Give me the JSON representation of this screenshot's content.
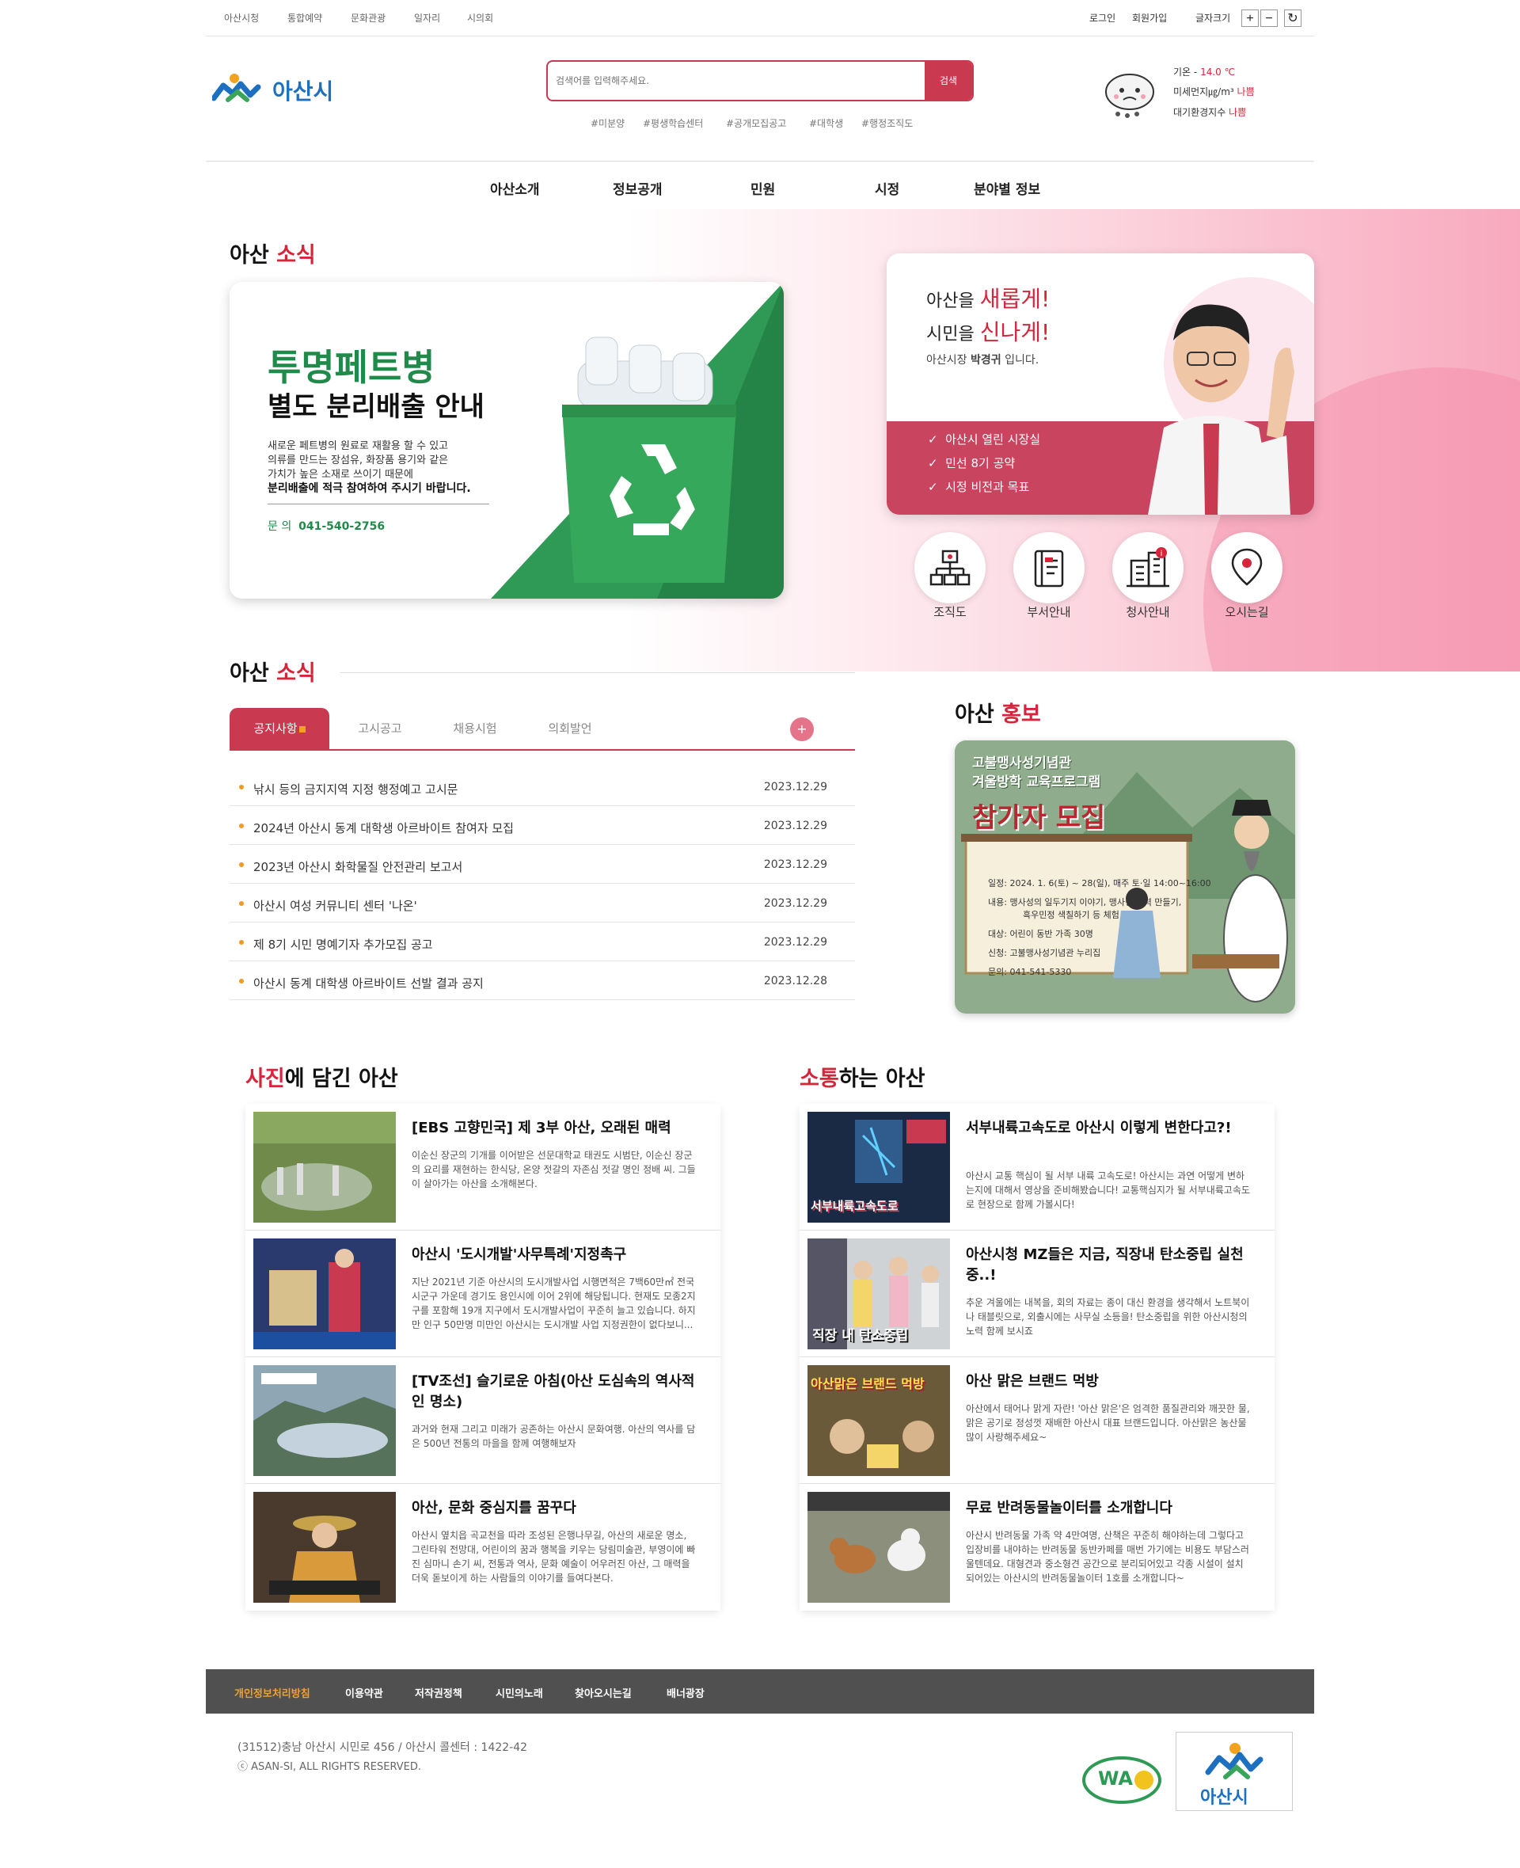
{
  "topbar": {
    "links": [
      "아산시청",
      "통합예약",
      "문화관광",
      "일자리",
      "시의회"
    ],
    "login": "로그인",
    "signup": "회원가입",
    "font_size_label": "글자크기",
    "zoom_in": "+",
    "zoom_out": "−",
    "reset": "↻"
  },
  "header": {
    "logo_text": "아산시",
    "search_placeholder": "검색어를 입력해주세요.",
    "search_button": "검색",
    "tags": [
      "#미분양",
      "#평생학습센터",
      "#공개모집공고",
      "#대학생",
      "#행정조직도"
    ],
    "weather": {
      "temp_label": "기온 -",
      "temp_value": "14.0 ℃",
      "dust_label": "미세먼지㎍/m³",
      "dust_value": "나쁨",
      "air_label": "대기환경지수",
      "air_value": "나쁨"
    }
  },
  "nav": [
    "아산소개",
    "정보공개",
    "민원",
    "시정",
    "분야별 정보"
  ],
  "hero": {
    "title_a": "아산",
    "title_b": "소식",
    "banner": {
      "headline1": "투명페트병",
      "headline2": "별도 분리배출 안내",
      "body1": "새로운 페트병의 원료로 재활용 할 수 있고",
      "body2": "의류를 만드는 장섬유, 화장품 용기와 같은",
      "body3": "가치가 높은 소재로 쓰이기 때문에",
      "body4": "분리배출에 적극 참여하여 주시기 바랍니다.",
      "contact_label": "문 의",
      "contact": "041-540-2756"
    },
    "mayor": {
      "line1a": "아산을",
      "line1b": "새롭게!",
      "line2a": "시민을",
      "line2b": "신나게!",
      "sub_a": "아산시장",
      "sub_b": "박경귀",
      "sub_c": "입니다.",
      "links": [
        "아산시 열린 시장실",
        "민선 8기 공약",
        "시정 비전과 목표"
      ]
    },
    "quick": [
      "조직도",
      "부서안내",
      "청사안내",
      "오시는길"
    ]
  },
  "news": {
    "title_a": "아산",
    "title_b": "소식",
    "tabs": [
      "공지사항",
      "고시공고",
      "채용시험",
      "의회발언"
    ],
    "more": "+",
    "items": [
      {
        "title": "낚시 등의 금지지역 지정 행정예고 고시문",
        "date": "2023.12.29"
      },
      {
        "title": "2024년 아산시 동계 대학생 아르바이트 참여자 모집",
        "date": "2023.12.29"
      },
      {
        "title": "2023년 아산시 화학물질 안전관리 보고서",
        "date": "2023.12.29"
      },
      {
        "title": "아산시 여성 커뮤니티 센터 '나온'",
        "date": "2023.12.29"
      },
      {
        "title": "제 8기 시민 명예기자 추가모집 공고",
        "date": "2023.12.29"
      },
      {
        "title": "아산시 동계 대학생 아르바이트 선발 결과 공지",
        "date": "2023.12.28"
      }
    ]
  },
  "promo": {
    "title_a": "아산",
    "title_b": "홍보",
    "line1": "고불맹사성기념관",
    "line2": "겨울방학 교육프로그램",
    "big": "참가자 모집",
    "date_label": "일정:",
    "date": "2024. 1. 6(토) ~ 28(일), 매주 토·일 14:00~16:00",
    "content_label": "내용:",
    "content1": "맹사성의 일두기지 이야기, 맹사성 달력 만들기,",
    "content2": "흑우민정 색칠하기 등 체험",
    "target": "대상: 어린이 동반 가족 30명",
    "apply": "신청: 고불맹사성기념관 누리집",
    "contact": "문의: 041-541-5330"
  },
  "photo": {
    "title_a": "사진",
    "title_b": "에 담긴 아산",
    "items": [
      {
        "title": "[EBS 고향민국] 제 3부 아산, 오래된 매력",
        "desc": "이순신 장군의 기개를 이어받은 선문대학교 태권도 시범단, 이순신 장군의 요리를 재현하는 한식당, 온양 젓갈의 자존심 젓갈 명인 정배 씨. 그들이 살아가는 아산을 소개해본다."
      },
      {
        "title": "아산시 '도시개발'사무특례'지정촉구",
        "desc": "지난 2021년 기준 아산시의 도시개발사업 시행면적은 7백60만㎡ 전국 시군구 가운데 경기도 용인시에 이어 2위에 해당됩니다. 현재도 모종2지구를 포함해 19개 지구에서 도시개발사업이 꾸준히 늘고 있습니다. 하지만 인구 50만명 미만인 아산시는 도시개발 사업 지정권한이 없다보니..."
      },
      {
        "title": "[TV조선] 슬기로운 아침(아산 도심속의 역사적인 명소)",
        "desc": "과거와 현재 그리고 미래가 공존하는 아산시 문화여행. 아산의 역사를 담은 500년 전통의 마을을 함께 여행해보자"
      },
      {
        "title": "아산, 문화 중심지를 꿈꾸다",
        "desc": "아산시 옆치읍 곡교천을 따라 조성된 은행나무길, 아산의 새로운 명소, 그린타워 전망대, 어린이의 꿈과 행복을 키우는 당림미술관, 부영이에 빠진 심마니 손기 씨, 전통과 역사, 문화 예술이 어우러진 아산, 그 매력을 더욱 돋보이게 하는 사람들의 이야기를 들여다본다."
      }
    ]
  },
  "comm": {
    "title_a": "소통",
    "title_b": "하는 아산",
    "items": [
      {
        "title": "서부내륙고속도로 아산시 이렇게 변한다고?!",
        "desc": "아산시 교통 핵심이 될 서부 내륙 고속도로! 아산시는 과연 어떻게 변하는지에 대해서 영상을 준비해봤습니다! 교통핵심지가 될 서부내륙고속도로 현장으로 함께 가볼시다!"
      },
      {
        "title": "아산시청 MZ들은 지금, 직장내 탄소중립 실천중..!",
        "desc": "추운 겨울에는 내복을, 회의 자료는 종이 대신 환경을 생각해서 노트북이나 태블릿으로, 외출시에는 사무실 소등을! 탄소중립을 위한 아산시청의 노력 함께 보시죠"
      },
      {
        "title": "아산 맑은 브랜드 먹방",
        "desc": "아산에서 태어나 맑게 자란! '아산 맑은'은 엄격한 품질관리와 깨끗한 물, 맑은 공기로 정성껏 재배한 아산시 대표 브랜드입니다. 아산맑은 농산물 많이 사랑해주세요~"
      },
      {
        "title": "무료 반려동물놀이터를 소개합니다",
        "desc": "아산시 반려동물 가족 약 4만여명, 산책은 꾸준히 해야하는데 그렇다고 입장비를 내야하는 반려동물 동반카페를 매번 가기에는 비용도 부담스러울텐데요. 대형견과 중소형견 공간으로 분리되어있고 각종 시설이 설치되어있는 아산시의 반려동물놀이터 1호를 소개합니다~"
      }
    ],
    "thumb_text": [
      "서부내륙고속도로",
      "직장 내 탄소중립",
      "아산맑은 브랜드 먹방"
    ]
  },
  "footer": {
    "links": [
      "개인정보처리방침",
      "이용약관",
      "저작권정책",
      "시민의노래",
      "찾아오시는길",
      "배너광장"
    ],
    "address": "(31512)충남 아산시 시민로 456 / 아산시 콜센터 : 1422-42",
    "copyright": "ⓒ ASAN-SI, ALL RIGHTS RESERVED.",
    "wa_mark": "WA",
    "logo_text": "아산시"
  },
  "colors": {
    "accent": "#c9394f",
    "red": "#d6253a",
    "green": "#2e9a55"
  }
}
